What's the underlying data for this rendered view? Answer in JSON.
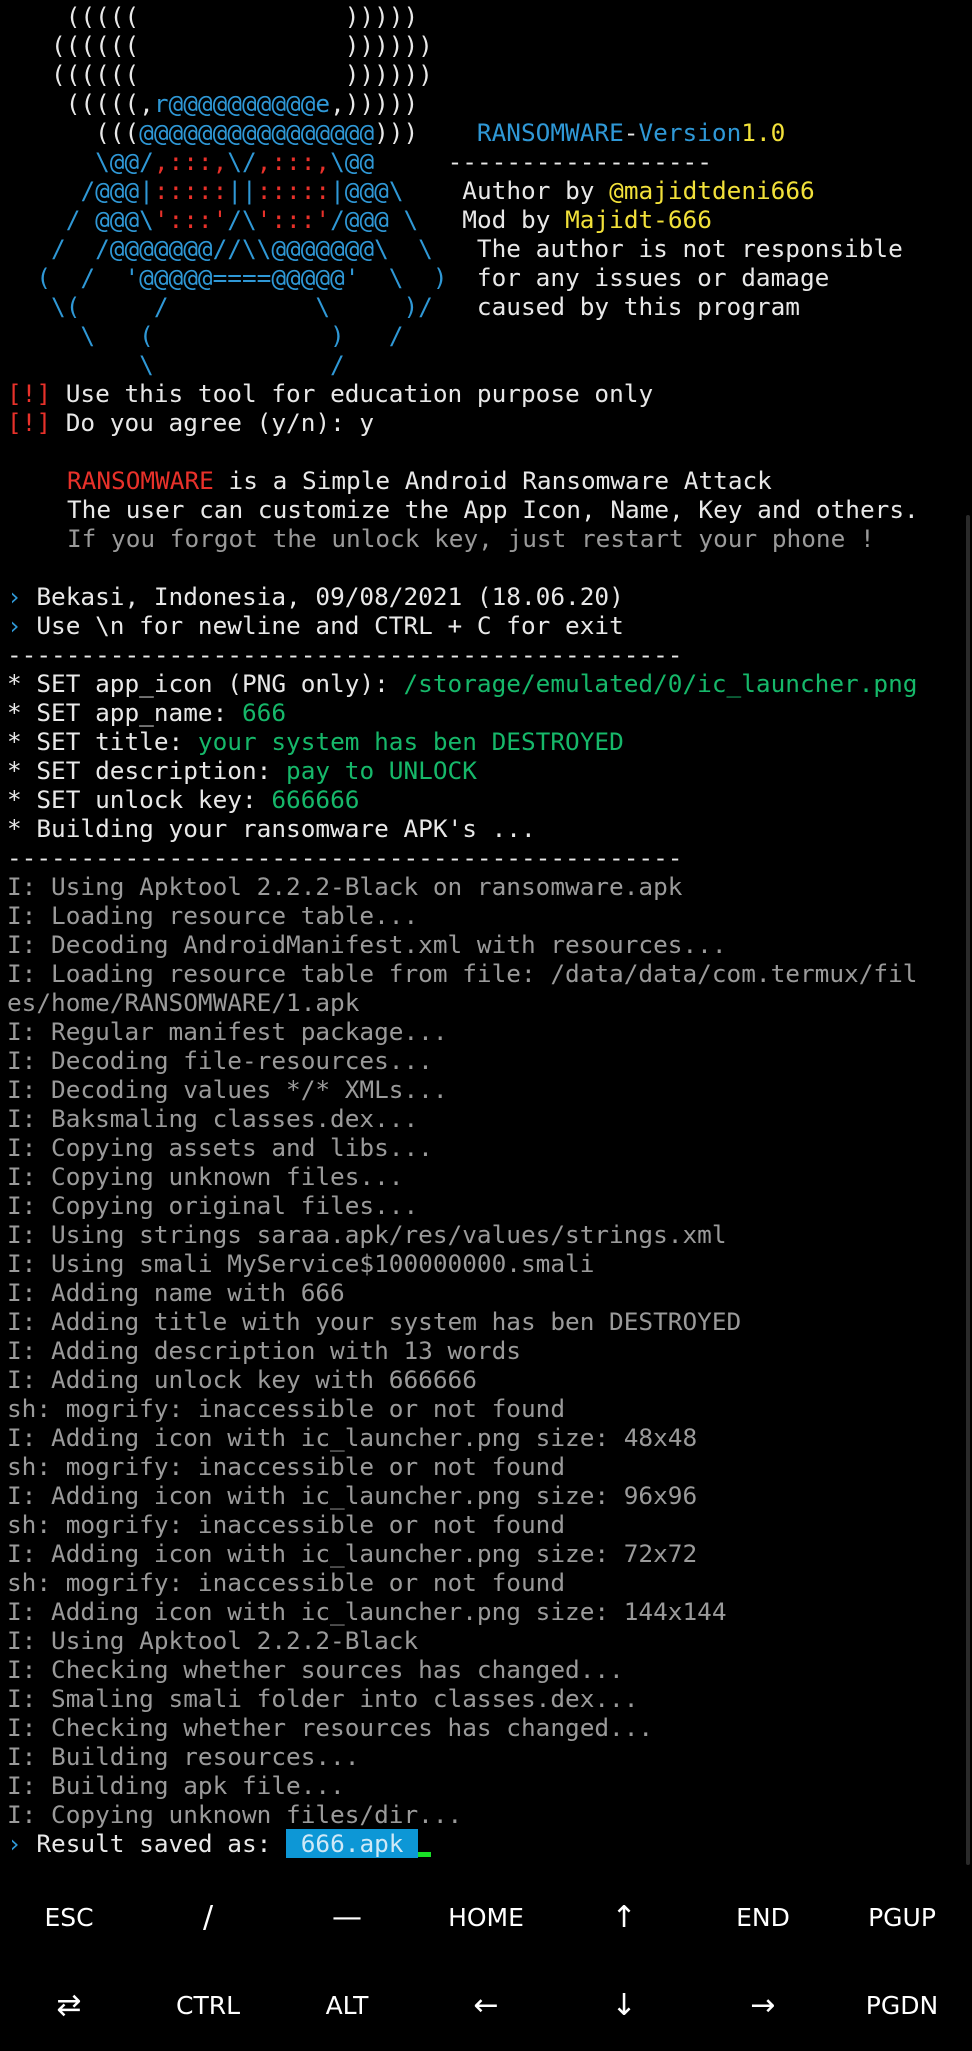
{
  "terminal": {
    "banner": [
      {
        "segs": [
          {
            "t": "    (((((              )))))",
            "c": "white"
          }
        ]
      },
      {
        "segs": [
          {
            "t": "   ((((((              ))))))",
            "c": "white"
          }
        ]
      },
      {
        "segs": [
          {
            "t": "   ((((((              ))))))",
            "c": "white"
          }
        ]
      },
      {
        "segs": [
          {
            "t": "    (((((,",
            "c": "white"
          },
          {
            "t": "r@@@@@@@@@@e",
            "c": "blue"
          },
          {
            "t": ",)))))",
            "c": "white"
          }
        ]
      },
      {
        "segs": [
          {
            "t": "      (((",
            "c": "white"
          },
          {
            "t": "@@@@@@@@@@@@@@@@",
            "c": "blue"
          },
          {
            "t": ")))    ",
            "c": "white"
          },
          {
            "t": "RANSOMWARE",
            "c": "blue"
          },
          {
            "t": "-",
            "c": "white"
          },
          {
            "t": "Version",
            "c": "blue"
          },
          {
            "t": "1.0",
            "c": "yellow"
          }
        ]
      },
      {
        "segs": [
          {
            "t": "      ",
            "c": "white"
          },
          {
            "t": "\\@@/",
            "c": "blue"
          },
          {
            "t": ",:::,",
            "c": "red"
          },
          {
            "t": "\\/",
            "c": "blue"
          },
          {
            "t": ",:::,",
            "c": "red"
          },
          {
            "t": "\\@@",
            "c": "blue"
          },
          {
            "t": "     ------------------",
            "c": "white"
          }
        ]
      },
      {
        "segs": [
          {
            "t": "     ",
            "c": "blue"
          },
          {
            "t": "/@@@|",
            "c": "blue"
          },
          {
            "t": ":::::",
            "c": "red"
          },
          {
            "t": "||",
            "c": "blue"
          },
          {
            "t": ":::::",
            "c": "red"
          },
          {
            "t": "|@@@\\",
            "c": "blue"
          },
          {
            "t": "    Author by ",
            "c": "white"
          },
          {
            "t": "@majidtdeni666",
            "c": "yellow"
          }
        ]
      },
      {
        "segs": [
          {
            "t": "    ",
            "c": "blue"
          },
          {
            "t": "/ @@@\\",
            "c": "blue"
          },
          {
            "t": "':::'",
            "c": "red"
          },
          {
            "t": "/\\",
            "c": "blue"
          },
          {
            "t": "':::'",
            "c": "red"
          },
          {
            "t": "/@@@ \\",
            "c": "blue"
          },
          {
            "t": "   Mod by ",
            "c": "white"
          },
          {
            "t": "Majidt-666",
            "c": "yellow"
          }
        ]
      },
      {
        "segs": [
          {
            "t": "   /  /@@@@@@@//\\\\@@@@@@@\\  \\",
            "c": "blue"
          },
          {
            "t": "   The author is not responsible",
            "c": "white"
          }
        ]
      },
      {
        "segs": [
          {
            "t": "  (  /  '@@@@@====@@@@@'  \\  )",
            "c": "blue"
          },
          {
            "t": "  for any issues or damage",
            "c": "white"
          }
        ]
      },
      {
        "segs": [
          {
            "t": "   \\(     /          \\     )/",
            "c": "blue"
          },
          {
            "t": "   caused by this program",
            "c": "white"
          }
        ]
      },
      {
        "segs": [
          {
            "t": "     \\   (            )   /",
            "c": "blue"
          }
        ]
      },
      {
        "segs": [
          {
            "t": "         \\            /",
            "c": "blue"
          }
        ]
      }
    ],
    "warn_bracket": "[!]",
    "warn1": " Use this tool for education purpose only",
    "warn2": " Do you agree (y/n): y",
    "desc_brand": "RANSOMWARE",
    "desc_rest": " is a Simple Android Ransomware Attack",
    "desc2": "The user can customize the App Icon, Name, Key and others.",
    "desc3": "If you forgot the unlock key, just restart your phone !",
    "prompt": "›",
    "location": "Bekasi, Indonesia, 09/08/2021 (18.06.20)",
    "help": "Use \\n for newline and CTRL + C for exit",
    "divider": "----------------------------------------------",
    "settings": [
      {
        "label": "* SET app_icon (PNG only): ",
        "value": "/storage/emulated/0/ic_launcher.png"
      },
      {
        "label": "* SET app_name: ",
        "value": "666"
      },
      {
        "label": "* SET title: ",
        "value": "your system has ben DESTROYED"
      },
      {
        "label": "* SET description: ",
        "value": "pay to UNLOCK"
      },
      {
        "label": "* SET unlock key: ",
        "value": "666666"
      }
    ],
    "building": "* Building your ransomware APK's ...",
    "log": [
      "I: Using Apktool 2.2.2-Black on ransomware.apk",
      "I: Loading resource table...",
      "I: Decoding AndroidManifest.xml with resources...",
      "I: Loading resource table from file: /data/data/com.termux/fil",
      "es/home/RANSOMWARE/1.apk",
      "I: Regular manifest package...",
      "I: Decoding file-resources...",
      "I: Decoding values */* XMLs...",
      "I: Baksmaling classes.dex...",
      "I: Copying assets and libs...",
      "I: Copying unknown files...",
      "I: Copying original files...",
      "I: Using strings saraa.apk/res/values/strings.xml",
      "I: Using smali MyService$100000000.smali",
      "I: Adding name with 666",
      "I: Adding title with your system has ben DESTROYED",
      "I: Adding description with 13 words",
      "I: Adding unlock key with 666666",
      "sh: mogrify: inaccessible or not found",
      "I: Adding icon with ic_launcher.png size: 48x48",
      "sh: mogrify: inaccessible or not found",
      "I: Adding icon with ic_launcher.png size: 96x96",
      "sh: mogrify: inaccessible or not found",
      "I: Adding icon with ic_launcher.png size: 72x72",
      "sh: mogrify: inaccessible or not found",
      "I: Adding icon with ic_launcher.png size: 144x144",
      "I: Using Apktool 2.2.2-Black",
      "I: Checking whether sources has changed...",
      "I: Smaling smali folder into classes.dex...",
      "I: Checking whether resources has changed...",
      "I: Building resources...",
      "I: Building apk file...",
      "I: Copying unknown files/dir..."
    ],
    "result_label": "Result saved as: ",
    "result_file": " 666.apk "
  },
  "extra_keys": {
    "row1": [
      {
        "label": "ESC",
        "icon": "esc-key"
      },
      {
        "label": "/",
        "icon": "slash-key"
      },
      {
        "label": "—",
        "icon": "dash-key"
      },
      {
        "label": "HOME",
        "icon": "home-key"
      },
      {
        "label": "↑",
        "icon": "arrow-up-icon"
      },
      {
        "label": "END",
        "icon": "end-key"
      },
      {
        "label": "PGUP",
        "icon": "page-up-key"
      }
    ],
    "row2": [
      {
        "label": "⇄",
        "icon": "tab-icon"
      },
      {
        "label": "CTRL",
        "icon": "ctrl-key"
      },
      {
        "label": "ALT",
        "icon": "alt-key"
      },
      {
        "label": "←",
        "icon": "arrow-left-icon"
      },
      {
        "label": "↓",
        "icon": "arrow-down-icon"
      },
      {
        "label": "→",
        "icon": "arrow-right-icon"
      },
      {
        "label": "PGDN",
        "icon": "page-down-key"
      }
    ]
  },
  "colors": {
    "background": "#000000",
    "text": "#e8e8e8",
    "grey": "#9a9a9a",
    "red": "#e8312a",
    "blue": "#2f98d6",
    "yellow": "#f2e13a",
    "green": "#16b86a",
    "selection": "#0d97d6",
    "cursor": "#19e027"
  }
}
